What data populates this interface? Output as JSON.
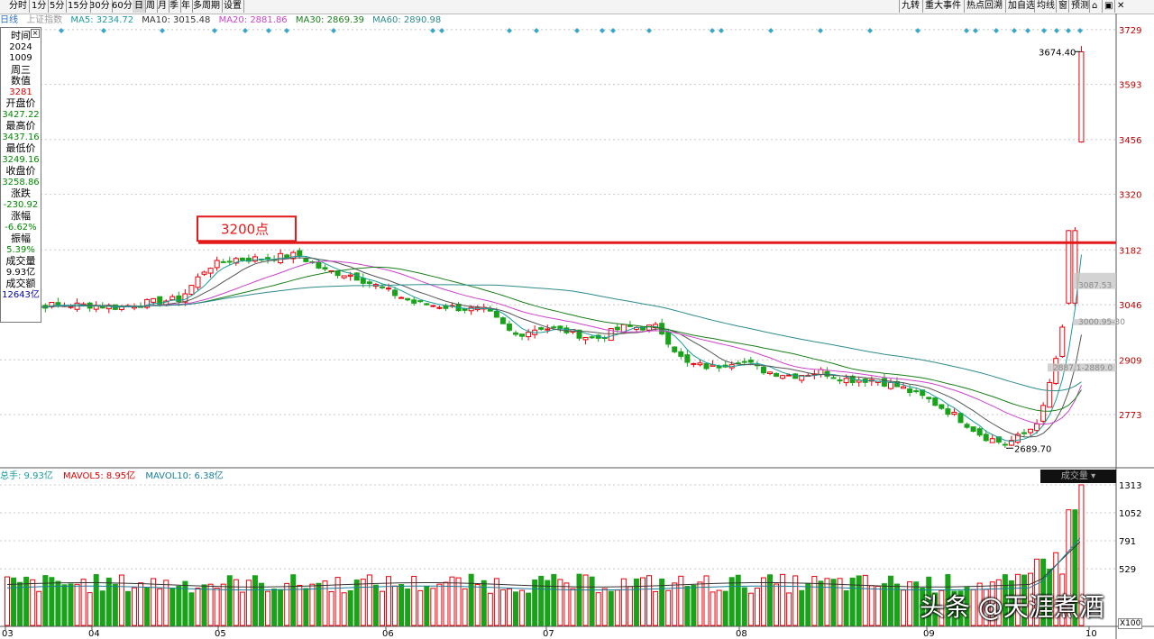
{
  "toolbar": {
    "periods": [
      "分时",
      "1分",
      "5分",
      "15分",
      "30分",
      "60分",
      "日",
      "周",
      "月",
      "季",
      "年",
      "多周期",
      "设置"
    ],
    "active": "日",
    "right_items": [
      "九转",
      "重大事件",
      "热点回溯",
      "加自选",
      "均线",
      "窗",
      "预测"
    ]
  },
  "ma_line": {
    "prefix": "日线",
    "index_name": "上证指数",
    "ma5": "MA5: 3234.72",
    "ma10": "MA10: 3015.48",
    "ma20": "MA20: 2881.86",
    "ma30": "MA30: 2869.39",
    "ma60": "MA60: 2890.98"
  },
  "colors": {
    "ma5": "#000000",
    "ma10": "#b8860b",
    "ma20": "#cc44cc",
    "ma30": "#1a7f1a",
    "ma60": "#2e8b8b",
    "up": "#e8000b",
    "down": "#1aa31a",
    "annotation": "#e31a1a"
  },
  "info": {
    "time_label": "时间",
    "date_year": "2024",
    "date_md": "1009",
    "weekday": "周三",
    "value_label": "数值",
    "value": "3281",
    "open_label": "开盘价",
    "open": "3427.22",
    "high_label": "最高价",
    "high": "3437.16",
    "low_label": "最低价",
    "low": "3249.16",
    "close_label": "收盘价",
    "close": "3258.86",
    "change_label": "涨跌",
    "change": "-230.92",
    "pct_label": "涨幅",
    "pct": "-6.62%",
    "amp_label": "振幅",
    "amp": "5.39%",
    "vol_label": "成交量",
    "vol": "9.93亿",
    "amt_label": "成交额",
    "amt": "12643亿"
  },
  "annotation": {
    "label": "3200点",
    "level": 3200
  },
  "price_axis": [
    "3729",
    "3593",
    "3456",
    "3320",
    "3182",
    "3046",
    "2909",
    "2773"
  ],
  "high_label": "3674.40",
  "low_label": "2689.70",
  "band_labels": [
    "3087.53",
    "3000.95-30",
    "2887.1-2889.0"
  ],
  "volume": {
    "total": "总手: 9.93亿",
    "mavol5": "MAVOL5: 8.95亿",
    "mavol10": "MAVOL10: 6.38亿",
    "tag": "成交量",
    "axis": [
      "1313",
      "1052",
      "791",
      "529"
    ]
  },
  "x_axis": [
    "03",
    "04",
    "05",
    "06",
    "07",
    "08",
    "09",
    "10"
  ],
  "watermark": "头条 @天涯煮酒",
  "scale_tag": "X100",
  "chart_data": {
    "type": "candlestick",
    "title": "上证指数 日线",
    "ylim": [
      2650,
      3740
    ],
    "hline": 3200,
    "x_months": [
      "03",
      "04",
      "05",
      "06",
      "07",
      "08",
      "09",
      "10"
    ],
    "ohlc_sample": {
      "date": "2024-10-09",
      "open": 3427.22,
      "high": 3437.16,
      "low": 3249.16,
      "close": 3258.86
    },
    "period_high": 3674.4,
    "period_low": 2689.7,
    "moving_averages": {
      "MA5": 3234.72,
      "MA10": 3015.48,
      "MA20": 2881.86,
      "MA30": 2869.39,
      "MA60": 2890.98
    },
    "volume_ylim": [
      0,
      1313
    ],
    "volume_ma": {
      "MAVOL5": "8.95亿",
      "MAVOL10": "6.38亿"
    }
  }
}
